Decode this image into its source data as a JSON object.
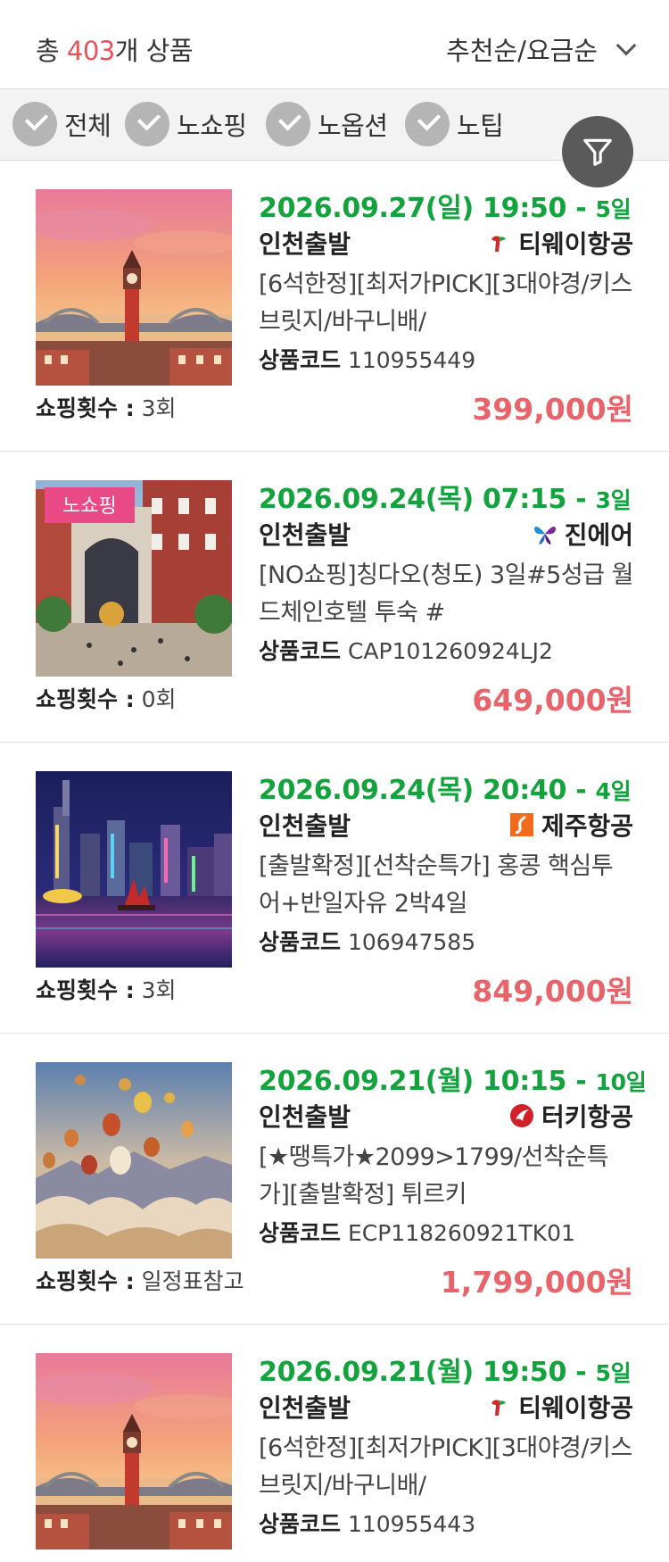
{
  "header": {
    "total_prefix": "총 ",
    "total_count": "403",
    "total_suffix": "개 상품",
    "sort_label": "추천순/요금순"
  },
  "filters": [
    {
      "label": "전체"
    },
    {
      "label": "노쇼핑"
    },
    {
      "label": "노옵션"
    },
    {
      "label": "노팁"
    }
  ],
  "filter_button_icon": "filter-icon",
  "colors": {
    "accent_red": "#e8525b",
    "date_green": "#12a33d",
    "price_red": "#e8646b",
    "no_shopping_tag": "#e94a86"
  },
  "labels": {
    "product_code": "상품코드",
    "shopping_count": "쇼핑횟수 :"
  },
  "products": [
    {
      "date": "2026.09.27(일) 19:50 - ",
      "duration": "5일",
      "depart": "인천출발",
      "airline": "티웨이항공",
      "airline_icon": "tway-logo-icon",
      "title": "[6석한정][최저가PICK][3대야경/키스브릿지/바구니배/",
      "code": "110955449",
      "shopping": "3회",
      "price": "399,000원",
      "image": "clock-tower-sunset"
    },
    {
      "tag": "노쇼핑",
      "date": "2026.09.24(목) 07:15 - ",
      "duration": "3일",
      "depart": "인천출발",
      "airline": "진에어",
      "airline_icon": "jinair-logo-icon",
      "title": "[NO쇼핑]칭다오(청도) 3일#5성급 월드체인호텔 투숙 #",
      "code": "CAP101260924LJ2",
      "shopping": "0회",
      "price": "649,000원",
      "image": "european-street-plaza"
    },
    {
      "date": "2026.09.24(목) 20:40 - ",
      "duration": "4일",
      "depart": "인천출발",
      "airline": "제주항공",
      "airline_icon": "jejuair-logo-icon",
      "title": "[출발확정][선착순특가] 홍콩 핵심투어+반일자유 2박4일",
      "code": "106947585",
      "shopping": "3회",
      "price": "849,000원",
      "image": "hongkong-night-harbor"
    },
    {
      "date": "2026.09.21(월) 10:15 - ",
      "duration": "10일",
      "depart": "인천출발",
      "airline": "터키항공",
      "airline_icon": "turkish-airlines-logo-icon",
      "title": "[★땡특가★2099>1799/선착순특가][출발확정] 튀르키",
      "code": "ECP118260921TK01",
      "shopping": "일정표참고",
      "price": "1,799,000원",
      "image": "cappadocia-balloons"
    },
    {
      "date": "2026.09.21(월) 19:50 - ",
      "duration": "5일",
      "depart": "인천출발",
      "airline": "티웨이항공",
      "airline_icon": "tway-logo-icon",
      "title": "[6석한정][최저가PICK][3대야경/키스브릿지/바구니배/",
      "code": "110955443",
      "shopping": "",
      "price": "",
      "image": "clock-tower-sunset"
    }
  ]
}
